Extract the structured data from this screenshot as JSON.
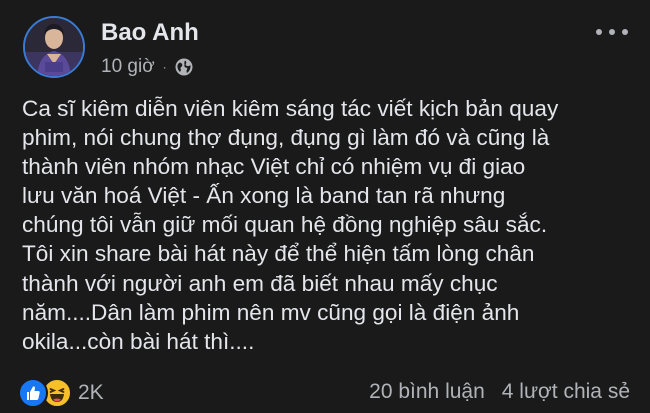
{
  "post": {
    "author": "Bao Anh",
    "time": "10 giờ",
    "separator": "·",
    "privacy_icon": "globe-icon",
    "more_icon": "more-horizontal-icon",
    "content_lines": [
      "Ca sĩ kiêm diễn viên kiêm sáng tác viết kịch bản quay",
      "phim, nói chung thợ đụng, đụng gì làm đó và cũng là",
      "thành viên nhóm nhạc Việt  chỉ có nhiệm vụ đi giao",
      "lưu văn hoá Việt - Ấn xong là band tan rã nhưng",
      "chúng tôi vẫn giữ mối quan hệ đồng nghiệp sâu sắc.",
      "Tôi xin share bài hát này để thể hiện tấm lòng chân",
      "thành với người anh em đã biết nhau mấy chục",
      "năm....Dân làm phim nên mv cũng gọi là điện ảnh",
      "okila...còn bài hát thì...."
    ],
    "reactions": {
      "icons": [
        "like-icon",
        "haha-icon"
      ],
      "count": "2K"
    },
    "comments": "20 bình luận",
    "shares": "4 lượt chia sẻ"
  },
  "colors": {
    "background": "#1a1a1a",
    "text_primary": "#e4e6eb",
    "text_secondary": "#b0b3b8",
    "like_blue": "#1877f2",
    "haha_yellow": "#f7c02b"
  }
}
